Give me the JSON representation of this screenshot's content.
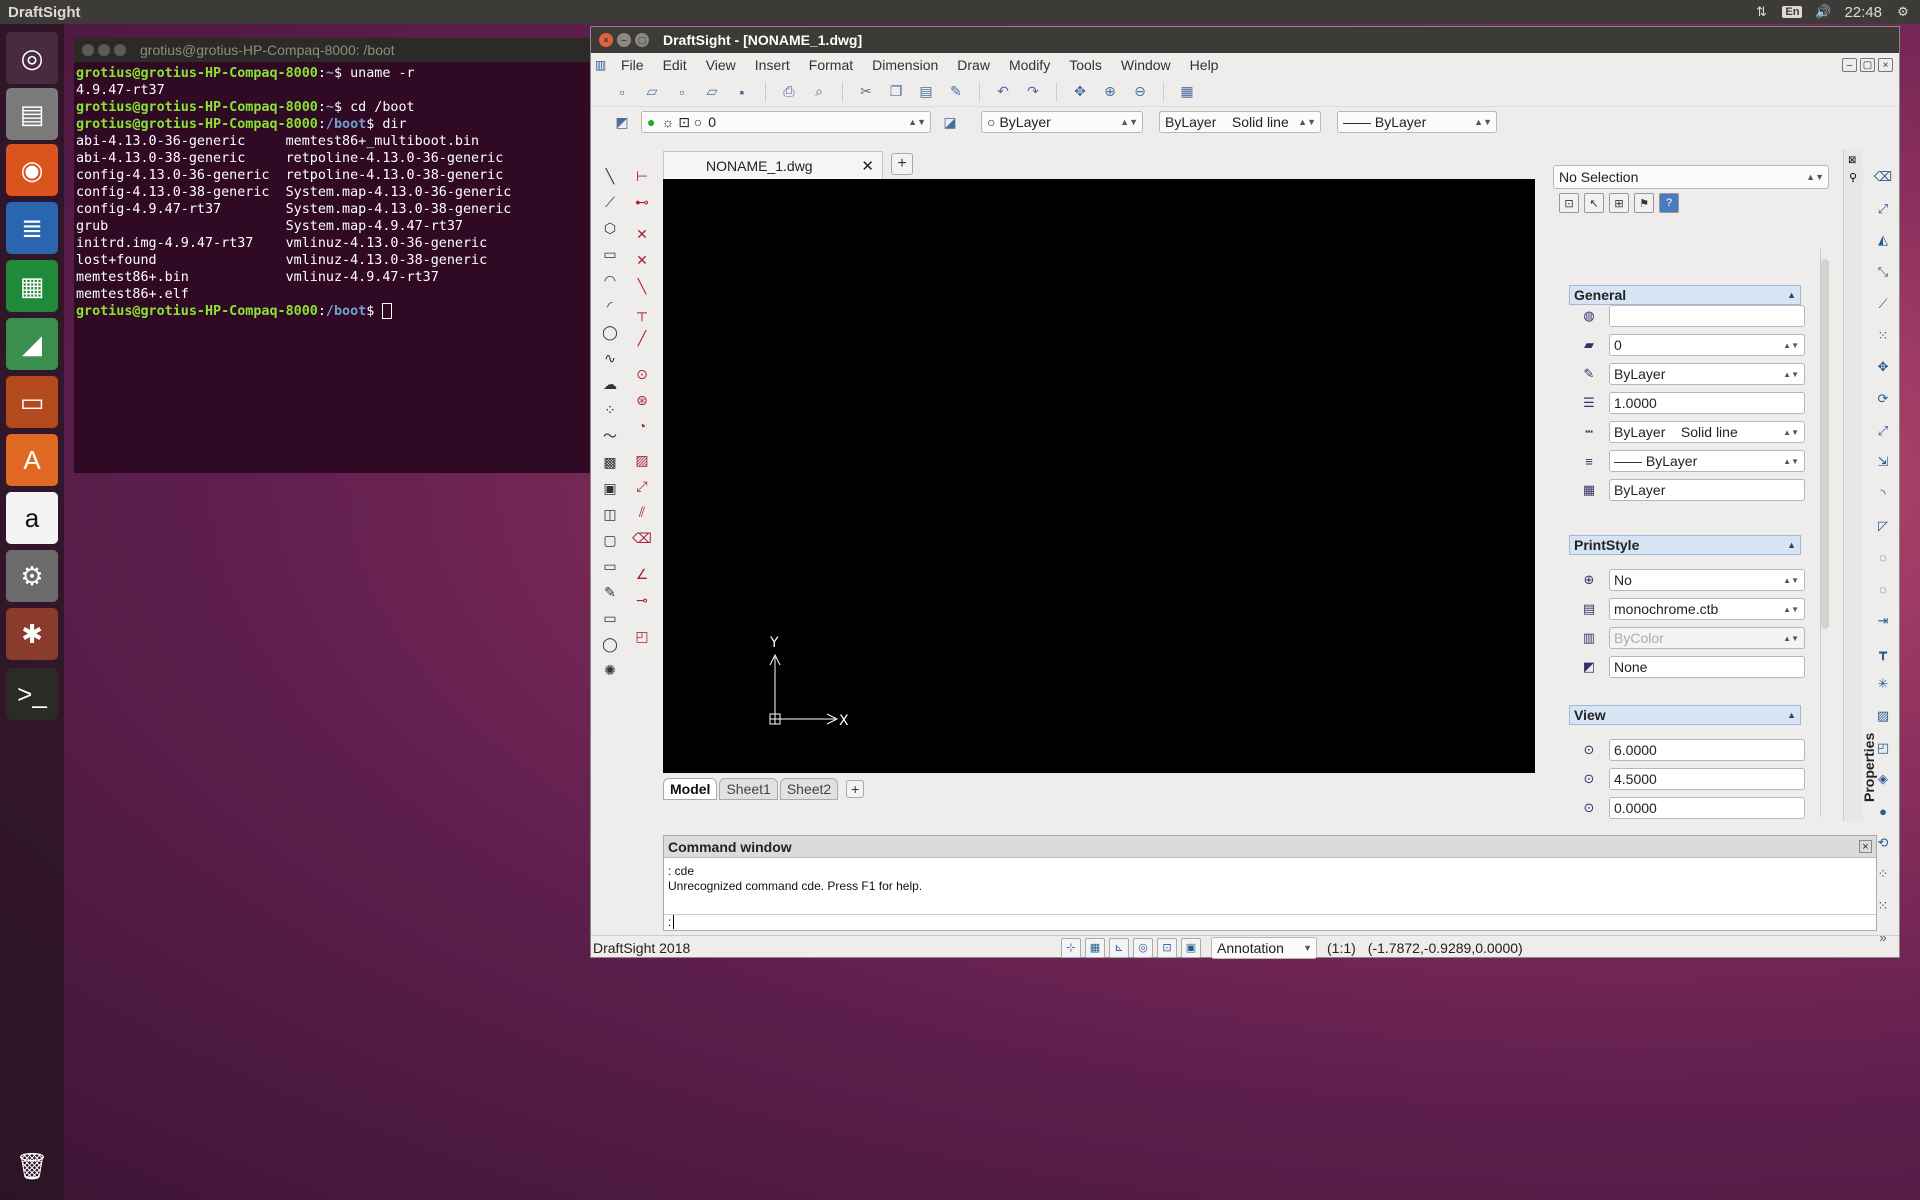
{
  "topbar": {
    "app": "DraftSight",
    "lang": "En",
    "time": "22:48"
  },
  "launcher": {
    "items": [
      "ubuntu-dash-icon",
      "files-icon",
      "firefox-icon",
      "writer-icon",
      "calc-icon",
      "draftsight-icon",
      "impress-icon",
      "software-center-icon",
      "amazon-icon",
      "system-settings-icon",
      "apps-icon",
      "terminal-icon",
      "trash-icon"
    ]
  },
  "terminal": {
    "title": "grotius@grotius-HP-Compaq-8000: /boot",
    "prompt_user": "grotius@grotius-HP-Compaq-8000",
    "lines": [
      {
        "p": "~",
        "cmd": "$ uname -r"
      },
      {
        "out": "4.9.47-rt37"
      },
      {
        "p": "~",
        "cmd": "$ cd /boot"
      },
      {
        "p": "/boot",
        "cmd": "$ dir"
      },
      {
        "out": "abi-4.13.0-36-generic     memtest86+_multiboot.bin"
      },
      {
        "out": "abi-4.13.0-38-generic     retpoline-4.13.0-36-generic"
      },
      {
        "out": "config-4.13.0-36-generic  retpoline-4.13.0-38-generic"
      },
      {
        "out": "config-4.13.0-38-generic  System.map-4.13.0-36-generic"
      },
      {
        "out": "config-4.9.47-rt37        System.map-4.13.0-38-generic"
      },
      {
        "out": "grub                      System.map-4.9.47-rt37"
      },
      {
        "out": "initrd.img-4.9.47-rt37    vmlinuz-4.13.0-36-generic"
      },
      {
        "out": "lost+found                vmlinuz-4.13.0-38-generic"
      },
      {
        "out": "memtest86+.bin            vmlinuz-4.9.47-rt37"
      },
      {
        "out": "memtest86+.elf"
      },
      {
        "p": "/boot",
        "cmd": "$ "
      }
    ]
  },
  "ds": {
    "title": "DraftSight - [NONAME_1.dwg]",
    "menu": [
      "File",
      "Edit",
      "View",
      "Insert",
      "Format",
      "Dimension",
      "Draw",
      "Modify",
      "Tools",
      "Window",
      "Help"
    ],
    "layer": "0",
    "color": "ByLayer",
    "linestyle": "ByLayer    Solid line",
    "lineweight": "—— ByLayer",
    "doc_tab": "NONAME_1.dwg",
    "sheets": [
      "Model",
      "Sheet1",
      "Sheet2"
    ],
    "axis_x": "X",
    "axis_y": "Y",
    "props": {
      "selection": "No Selection",
      "general": "General",
      "general_rows": [
        "",
        "0",
        "ByLayer",
        "1.0000",
        "ByLayer    Solid line",
        "—— ByLayer",
        "ByLayer"
      ],
      "printstyle": "PrintStyle",
      "print_rows": [
        "No",
        "monochrome.ctb",
        "ByColor",
        "None"
      ],
      "view": "View",
      "view_rows": [
        "6.0000",
        "4.5000",
        "0.0000"
      ],
      "panel_label": "Properties"
    },
    "cmd": {
      "title": "Command window",
      "line1": ": cde",
      "line2": "Unrecognized command cde. Press F1 for help.",
      "prompt": ":"
    },
    "status": {
      "version": "DraftSight 2018",
      "annotation": "Annotation",
      "scale": "(1:1)",
      "coords": "(-1.7872,-0.9289,0.0000)"
    }
  }
}
